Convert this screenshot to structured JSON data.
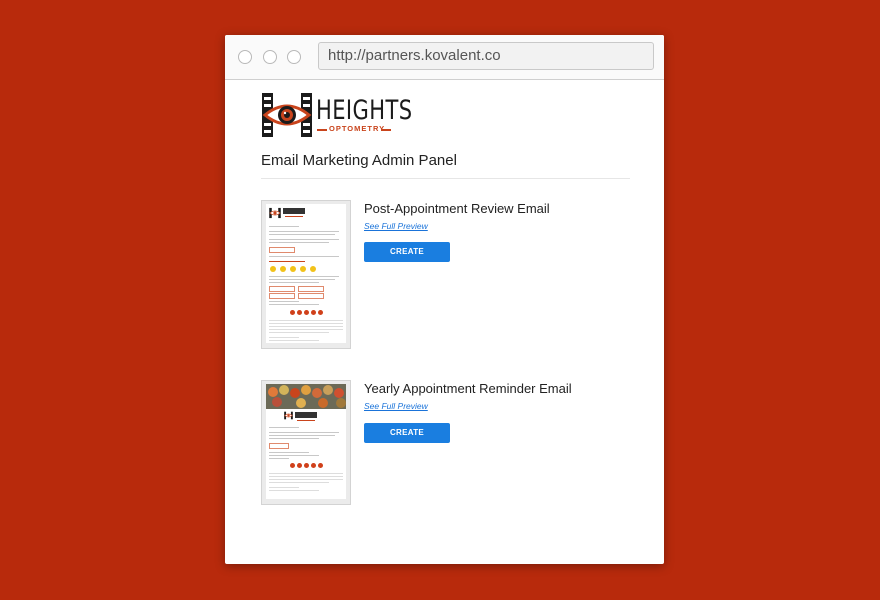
{
  "browser": {
    "url": "http://partners.kovalent.co"
  },
  "brand": {
    "name": "HEIGHTS",
    "subname": "OPTOMETRY",
    "accent_color": "#c9441c",
    "logo_icon": "eye-icon"
  },
  "page": {
    "title": "Email Marketing Admin Panel"
  },
  "emails": [
    {
      "title": "Post-Appointment Review Email",
      "preview_label": "See Full Preview",
      "create_label": "CREATE"
    },
    {
      "title": "Yearly Appointment Reminder Email",
      "preview_label": "See Full Preview",
      "create_label": "CREATE"
    }
  ],
  "colors": {
    "background": "#b82a0c",
    "button": "#1a7ee0",
    "link": "#1a73d9"
  }
}
